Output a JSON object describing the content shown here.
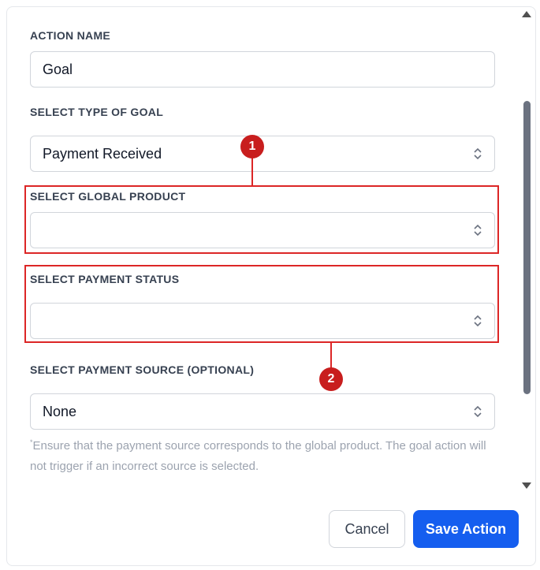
{
  "form": {
    "action_name": {
      "label": "ACTION NAME",
      "value": "Goal"
    },
    "goal_type": {
      "label": "SELECT TYPE OF GOAL",
      "value": "Payment Received"
    },
    "global_product": {
      "label": "SELECT GLOBAL PRODUCT",
      "value": ""
    },
    "payment_status": {
      "label": "SELECT PAYMENT STATUS",
      "value": ""
    },
    "payment_source": {
      "label": "SELECT PAYMENT SOURCE (OPTIONAL)",
      "value": "None"
    },
    "helper_mark": "*",
    "helper_text": "Ensure that the payment source corresponds to the global product. The goal action will not trigger if an incorrect source is selected."
  },
  "annotations": {
    "badge_1": "1",
    "badge_2": "2",
    "color": "#dc2626"
  },
  "buttons": {
    "cancel": "Cancel",
    "save": "Save Action",
    "save_color": "#155eef"
  },
  "icons": [
    "chevron-up-down-icon",
    "scroll-up-arrow-icon",
    "scroll-down-arrow-icon"
  ]
}
